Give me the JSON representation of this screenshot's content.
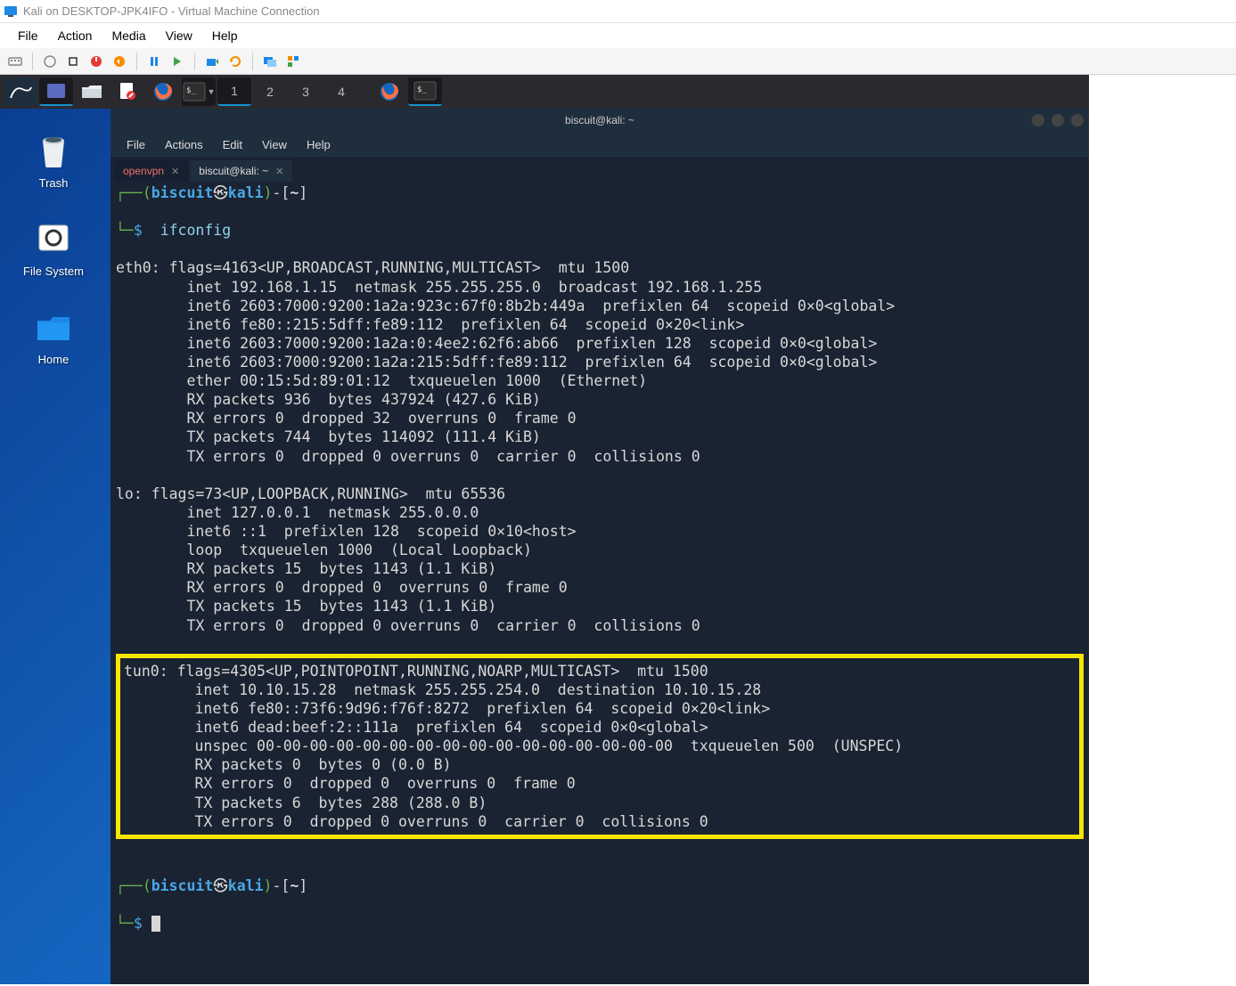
{
  "window": {
    "title": "Kali on DESKTOP-JPK4IFO - Virtual Machine Connection"
  },
  "win_menu": {
    "file": "File",
    "action": "Action",
    "media": "Media",
    "view": "View",
    "help": "Help"
  },
  "kali_taskbar": {
    "n1": "1",
    "n2": "2",
    "n3": "3",
    "n4": "4"
  },
  "desktop": {
    "trash": "Trash",
    "filesystem": "File System",
    "home": "Home"
  },
  "terminal": {
    "title": "biscuit@kali: ~",
    "menu": {
      "file": "File",
      "actions": "Actions",
      "edit": "Edit",
      "view": "View",
      "help": "Help"
    },
    "tabs": {
      "openvpn": "openvpn",
      "main": "biscuit@kali: ~"
    },
    "prompt": {
      "user": "biscuit",
      "host": "kali",
      "path": "~",
      "cmd1": "ifconfig"
    },
    "output": {
      "eth0": "eth0: flags=4163<UP,BROADCAST,RUNNING,MULTICAST>  mtu 1500\n        inet 192.168.1.15  netmask 255.255.255.0  broadcast 192.168.1.255\n        inet6 2603:7000:9200:1a2a:923c:67f0:8b2b:449a  prefixlen 64  scopeid 0×0<global>\n        inet6 fe80::215:5dff:fe89:112  prefixlen 64  scopeid 0×20<link>\n        inet6 2603:7000:9200:1a2a:0:4ee2:62f6:ab66  prefixlen 128  scopeid 0×0<global>\n        inet6 2603:7000:9200:1a2a:215:5dff:fe89:112  prefixlen 64  scopeid 0×0<global>\n        ether 00:15:5d:89:01:12  txqueuelen 1000  (Ethernet)\n        RX packets 936  bytes 437924 (427.6 KiB)\n        RX errors 0  dropped 32  overruns 0  frame 0\n        TX packets 744  bytes 114092 (111.4 KiB)\n        TX errors 0  dropped 0 overruns 0  carrier 0  collisions 0",
      "lo": "lo: flags=73<UP,LOOPBACK,RUNNING>  mtu 65536\n        inet 127.0.0.1  netmask 255.0.0.0\n        inet6 ::1  prefixlen 128  scopeid 0×10<host>\n        loop  txqueuelen 1000  (Local Loopback)\n        RX packets 15  bytes 1143 (1.1 KiB)\n        RX errors 0  dropped 0  overruns 0  frame 0\n        TX packets 15  bytes 1143 (1.1 KiB)\n        TX errors 0  dropped 0 overruns 0  carrier 0  collisions 0",
      "tun0": "tun0: flags=4305<UP,POINTOPOINT,RUNNING,NOARP,MULTICAST>  mtu 1500\n        inet 10.10.15.28  netmask 255.255.254.0  destination 10.10.15.28\n        inet6 fe80::73f6:9d96:f76f:8272  prefixlen 64  scopeid 0×20<link>\n        inet6 dead:beef:2::111a  prefixlen 64  scopeid 0×0<global>\n        unspec 00-00-00-00-00-00-00-00-00-00-00-00-00-00-00-00  txqueuelen 500  (UNSPEC)\n        RX packets 0  bytes 0 (0.0 B)\n        RX errors 0  dropped 0  overruns 0  frame 0\n        TX packets 6  bytes 288 (288.0 B)\n        TX errors 0  dropped 0 overruns 0  carrier 0  collisions 0"
    }
  }
}
